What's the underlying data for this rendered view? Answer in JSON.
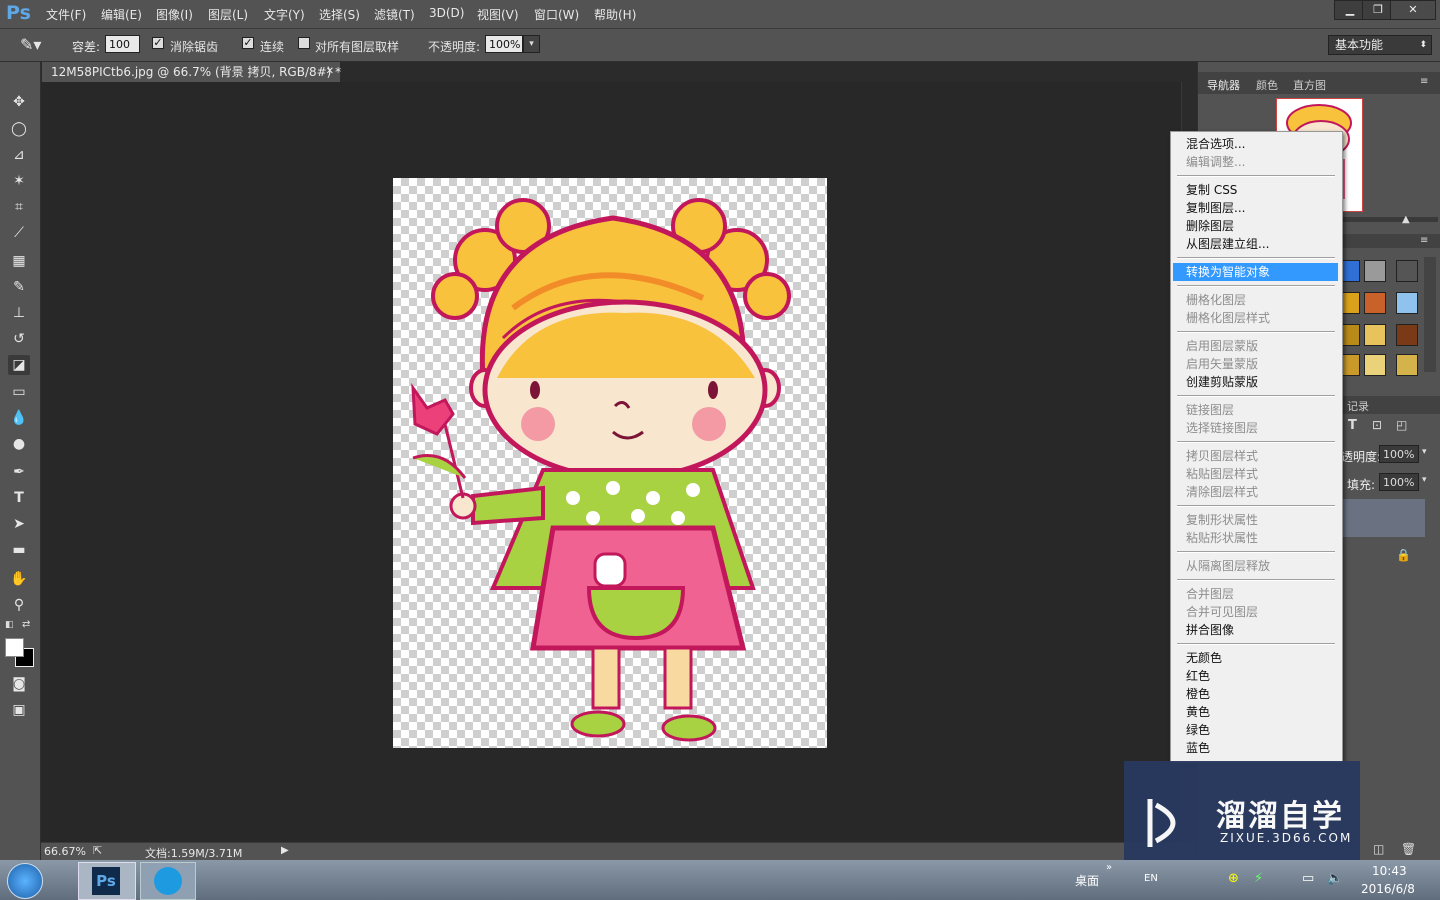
{
  "app": {
    "logo": "Ps"
  },
  "menubar": {
    "items": [
      "文件(F)",
      "编辑(E)",
      "图像(I)",
      "图层(L)",
      "文字(Y)",
      "选择(S)",
      "滤镜(T)",
      "3D(D)",
      "视图(V)",
      "窗口(W)",
      "帮助(H)"
    ],
    "window_controls": [
      "minimize-icon",
      "restore-icon",
      "close-icon"
    ]
  },
  "options": {
    "tolerance_label": "容差:",
    "tolerance_value": "100",
    "antialias_label": "消除锯齿",
    "antialias_checked": true,
    "contiguous_label": "连续",
    "contiguous_checked": true,
    "sample_all_label": "对所有图层取样",
    "sample_all_checked": false,
    "opacity_label": "不透明度:",
    "opacity_value": "100%",
    "workspace": "基本功能"
  },
  "document": {
    "tab_title": "12M58PICtb6.jpg @ 66.7% (背景 拷贝, RGB/8#) *",
    "zoom": "66.67%",
    "doc_info": "文档:1.59M/3.71M"
  },
  "tools": [
    "move-icon",
    "ellipse-marquee-icon",
    "polygon-lasso-icon",
    "magic-wand-icon",
    "crop-icon",
    "eyedropper-icon",
    "healing-brush-icon",
    "brush-icon",
    "clone-stamp-icon",
    "history-brush-icon",
    "eraser-icon",
    "gradient-icon",
    "blur-icon",
    "dodge-icon",
    "pen-icon",
    "type-icon",
    "path-select-icon",
    "rectangle-icon",
    "hand-icon",
    "zoom-icon"
  ],
  "right_panel": {
    "tabs": [
      "导航器",
      "颜色",
      "直方图"
    ],
    "history_label": "记录",
    "opacity_label": "透明度:",
    "opacity_value": "100%",
    "fill_label": "填充:",
    "fill_value": "100%"
  },
  "context_menu": {
    "items": [
      {
        "label": "混合选项...",
        "enabled": true
      },
      {
        "label": "编辑调整...",
        "enabled": false
      },
      {
        "sep": true
      },
      {
        "label": "复制 CSS",
        "enabled": true
      },
      {
        "label": "复制图层...",
        "enabled": true
      },
      {
        "label": "删除图层",
        "enabled": true
      },
      {
        "label": "从图层建立组...",
        "enabled": true
      },
      {
        "sep": true
      },
      {
        "label": "转换为智能对象",
        "enabled": true,
        "highlighted": true
      },
      {
        "sep": true
      },
      {
        "label": "栅格化图层",
        "enabled": false
      },
      {
        "label": "栅格化图层样式",
        "enabled": false
      },
      {
        "sep": true
      },
      {
        "label": "启用图层蒙版",
        "enabled": false
      },
      {
        "label": "启用矢量蒙版",
        "enabled": false
      },
      {
        "label": "创建剪贴蒙版",
        "enabled": true
      },
      {
        "sep": true
      },
      {
        "label": "链接图层",
        "enabled": false
      },
      {
        "label": "选择链接图层",
        "enabled": false
      },
      {
        "sep": true
      },
      {
        "label": "拷贝图层样式",
        "enabled": false
      },
      {
        "label": "粘贴图层样式",
        "enabled": false
      },
      {
        "label": "清除图层样式",
        "enabled": false
      },
      {
        "sep": true
      },
      {
        "label": "复制形状属性",
        "enabled": false
      },
      {
        "label": "粘贴形状属性",
        "enabled": false
      },
      {
        "sep": true
      },
      {
        "label": "从隔离图层释放",
        "enabled": false
      },
      {
        "sep": true
      },
      {
        "label": "合并图层",
        "enabled": false
      },
      {
        "label": "合并可见图层",
        "enabled": false
      },
      {
        "label": "拼合图像",
        "enabled": true
      },
      {
        "sep": true
      },
      {
        "label": "无颜色",
        "enabled": true
      },
      {
        "label": "红色",
        "enabled": true
      },
      {
        "label": "橙色",
        "enabled": true
      },
      {
        "label": "黄色",
        "enabled": true
      },
      {
        "label": "绿色",
        "enabled": true
      },
      {
        "label": "蓝色",
        "enabled": true
      }
    ]
  },
  "watermark": {
    "title": "溜溜自学",
    "subtitle": "ZIXUE.3D66.COM"
  },
  "taskbar": {
    "desktop_label": "桌面",
    "lang": "EN",
    "time": "10:43",
    "date": "2016/6/8"
  },
  "colors": {
    "ps_blue": "#5fa8e8",
    "menu_highlight": "#3399ff",
    "panel_bg": "#535353",
    "canvas_bg": "#282828"
  }
}
